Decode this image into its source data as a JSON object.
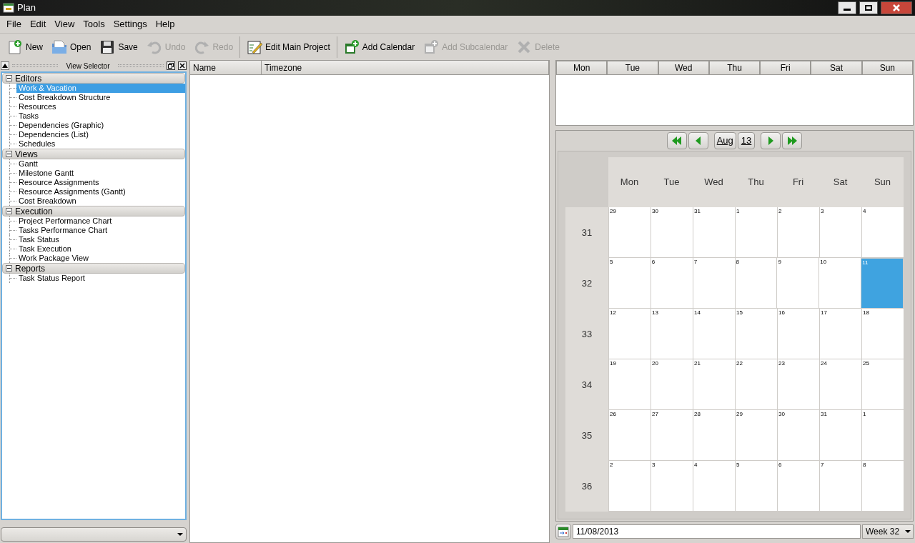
{
  "window": {
    "title": "Plan"
  },
  "menu": [
    "File",
    "Edit",
    "View",
    "Tools",
    "Settings",
    "Help"
  ],
  "toolbar": [
    {
      "kind": "new",
      "label": "New",
      "disabled": false
    },
    {
      "kind": "open",
      "label": "Open",
      "disabled": false
    },
    {
      "kind": "save",
      "label": "Save",
      "disabled": false
    },
    {
      "kind": "undo",
      "label": "Undo",
      "disabled": true
    },
    {
      "kind": "redo",
      "label": "Redo",
      "disabled": true
    },
    {
      "kind": "edit",
      "label": "Edit Main Project",
      "disabled": false
    },
    {
      "kind": "add",
      "label": "Add Calendar",
      "disabled": false
    },
    {
      "kind": "addsub",
      "label": "Add Subcalendar",
      "disabled": true
    },
    {
      "kind": "delete",
      "label": "Delete",
      "disabled": true
    }
  ],
  "view_selector": {
    "title": "View Selector",
    "groups": [
      {
        "label": "Editors",
        "expanded": true,
        "children": [
          {
            "label": "Work & Vacation",
            "selected": true
          },
          {
            "label": "Cost Breakdown Structure",
            "selected": false
          },
          {
            "label": "Resources",
            "selected": false
          },
          {
            "label": "Tasks",
            "selected": false
          },
          {
            "label": "Dependencies (Graphic)",
            "selected": false
          },
          {
            "label": "Dependencies (List)",
            "selected": false
          },
          {
            "label": "Schedules",
            "selected": false
          }
        ]
      },
      {
        "label": "Views",
        "expanded": true,
        "children": [
          {
            "label": "Gantt",
            "selected": false
          },
          {
            "label": "Milestone Gantt",
            "selected": false
          },
          {
            "label": "Resource Assignments",
            "selected": false
          },
          {
            "label": "Resource Assignments (Gantt)",
            "selected": false
          },
          {
            "label": "Cost Breakdown",
            "selected": false
          }
        ]
      },
      {
        "label": "Execution",
        "expanded": true,
        "children": [
          {
            "label": "Project Performance Chart",
            "selected": false
          },
          {
            "label": "Tasks Performance Chart",
            "selected": false
          },
          {
            "label": "Task Status",
            "selected": false
          },
          {
            "label": "Task Execution",
            "selected": false
          },
          {
            "label": "Work Package View",
            "selected": false
          }
        ]
      },
      {
        "label": "Reports",
        "expanded": true,
        "children": [
          {
            "label": "Task Status Report",
            "selected": false
          }
        ]
      }
    ]
  },
  "calendar_table": {
    "columns": [
      "Name",
      "Timezone"
    ]
  },
  "week_header": {
    "columns": [
      "Mon",
      "Tue",
      "Wed",
      "Thu",
      "Fri",
      "Sat",
      "Sun"
    ]
  },
  "month_view": {
    "month": "Aug",
    "year": "13",
    "weekdays": [
      "Mon",
      "Tue",
      "Wed",
      "Thu",
      "Fri",
      "Sat",
      "Sun"
    ],
    "weeks": [
      {
        "week": "31",
        "days": [
          {
            "day": "29",
            "selected": false
          },
          {
            "day": "30",
            "selected": false
          },
          {
            "day": "31",
            "selected": false
          },
          {
            "day": "1",
            "selected": false
          },
          {
            "day": "2",
            "selected": false
          },
          {
            "day": "3",
            "selected": false
          },
          {
            "day": "4",
            "selected": false
          }
        ]
      },
      {
        "week": "32",
        "days": [
          {
            "day": "5",
            "selected": false
          },
          {
            "day": "6",
            "selected": false
          },
          {
            "day": "7",
            "selected": false
          },
          {
            "day": "8",
            "selected": false
          },
          {
            "day": "9",
            "selected": false
          },
          {
            "day": "10",
            "selected": false
          },
          {
            "day": "11",
            "selected": true
          }
        ]
      },
      {
        "week": "33",
        "days": [
          {
            "day": "12",
            "selected": false
          },
          {
            "day": "13",
            "selected": false
          },
          {
            "day": "14",
            "selected": false
          },
          {
            "day": "15",
            "selected": false
          },
          {
            "day": "16",
            "selected": false
          },
          {
            "day": "17",
            "selected": false
          },
          {
            "day": "18",
            "selected": false
          }
        ]
      },
      {
        "week": "34",
        "days": [
          {
            "day": "19",
            "selected": false
          },
          {
            "day": "20",
            "selected": false
          },
          {
            "day": "21",
            "selected": false
          },
          {
            "day": "22",
            "selected": false
          },
          {
            "day": "23",
            "selected": false
          },
          {
            "day": "24",
            "selected": false
          },
          {
            "day": "25",
            "selected": false
          }
        ]
      },
      {
        "week": "35",
        "days": [
          {
            "day": "26",
            "selected": false
          },
          {
            "day": "27",
            "selected": false
          },
          {
            "day": "28",
            "selected": false
          },
          {
            "day": "29",
            "selected": false
          },
          {
            "day": "30",
            "selected": false
          },
          {
            "day": "31",
            "selected": false
          },
          {
            "day": "1",
            "selected": false
          }
        ]
      },
      {
        "week": "36",
        "days": [
          {
            "day": "2",
            "selected": false
          },
          {
            "day": "3",
            "selected": false
          },
          {
            "day": "4",
            "selected": false
          },
          {
            "day": "5",
            "selected": false
          },
          {
            "day": "6",
            "selected": false
          },
          {
            "day": "7",
            "selected": false
          },
          {
            "day": "8",
            "selected": false
          }
        ]
      }
    ],
    "date": "11/08/2013",
    "week_label": "Week 32"
  }
}
